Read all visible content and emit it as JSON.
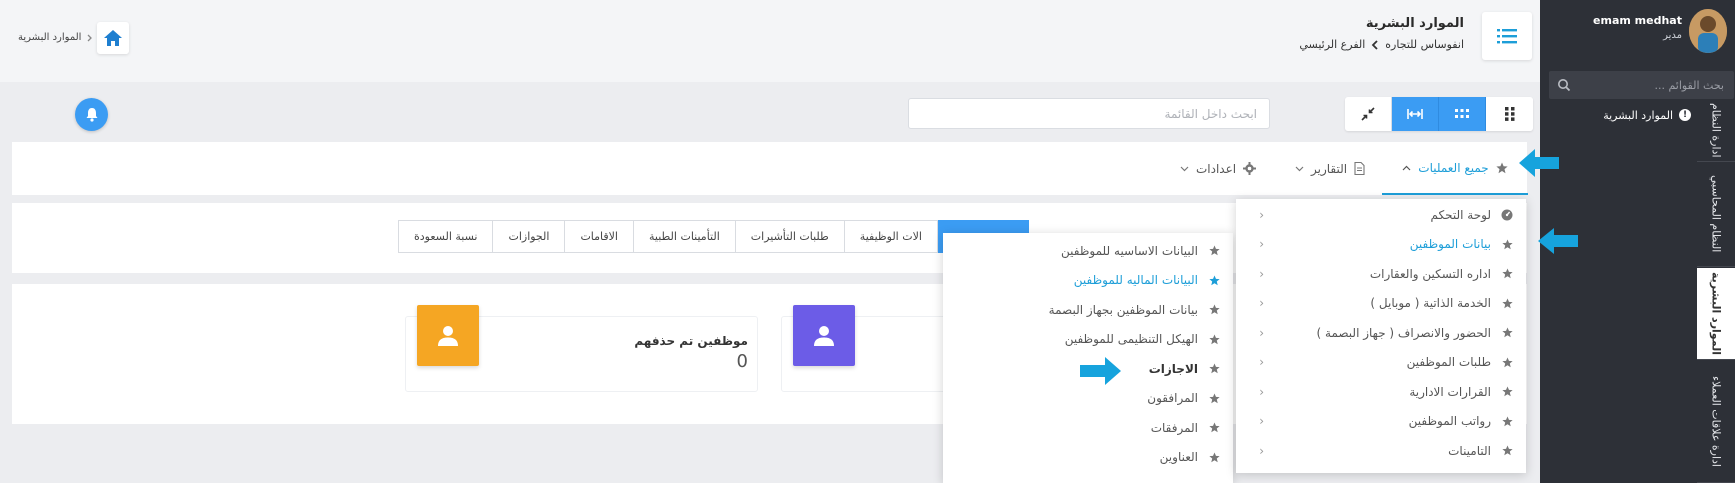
{
  "sidebar": {
    "user_name": "emam medhat",
    "user_role": "مدير",
    "search_placeholder": "بحث القوائم ...",
    "active_item": "الموارد البشرية",
    "vertical_tabs": [
      "ادارة النظام",
      "النظام المحاسبي",
      "الموارد البشرية",
      "ادارة علاقات العملاء"
    ]
  },
  "header": {
    "title": "الموارد البشرية",
    "breadcrumb": [
      "انفوساس للتجاره",
      "الفرع الرئيسي"
    ],
    "left_breadcrumb": "الموارد البشرية"
  },
  "toolbar": {
    "search_placeholder": "ابحث داخل القائمة"
  },
  "tabs": [
    {
      "label": "جميع العمليات",
      "active": true
    },
    {
      "label": "التقارير"
    },
    {
      "label": "اعدادات"
    }
  ],
  "subtabs": [
    {
      "label": "",
      "active": true
    },
    {
      "label": "الات الوظيفية"
    },
    {
      "label": "طلبات التأشيرات"
    },
    {
      "label": "التأمينات الطبية"
    },
    {
      "label": "الاقامات"
    },
    {
      "label": "الجوازات"
    },
    {
      "label": "نسبة السعودة"
    }
  ],
  "stats": [
    {
      "label": "موظفين تم حذفهم",
      "value": "0",
      "color": "#f5a623"
    },
    {
      "color": "#6c5ce7"
    }
  ],
  "dropdown_main": [
    {
      "label": "لوحة التحكم",
      "icon": "dashboard-icon"
    },
    {
      "label": "بيانات الموظفين",
      "icon": "star-icon",
      "highlighted": true
    },
    {
      "label": "اداره التسكين والعقارات",
      "icon": "star-icon"
    },
    {
      "label": "الخدمة الذاتية ( موبايل )",
      "icon": "star-icon"
    },
    {
      "label": "الحضور والانصراف ( جهاز البصمة )",
      "icon": "star-icon"
    },
    {
      "label": "طلبات الموظفين",
      "icon": "star-icon"
    },
    {
      "label": "القرارات الادارية",
      "icon": "star-icon"
    },
    {
      "label": "رواتب الموظفين",
      "icon": "star-icon"
    },
    {
      "label": "التامينات",
      "icon": "star-icon"
    }
  ],
  "dropdown_sub": [
    {
      "label": "البيانات الاساسيه للموظفين"
    },
    {
      "label": "البيانات الماليه للموظفين",
      "highlighted": true
    },
    {
      "label": "بيانات الموظفين بجهاز البصمة"
    },
    {
      "label": "الهيكل التنظيمى للموظفين"
    },
    {
      "label": "الاجازات",
      "bold": true
    },
    {
      "label": "المرافقون"
    },
    {
      "label": "المرفقات"
    },
    {
      "label": "العناوين"
    }
  ],
  "colors": {
    "accent": "#1d9ed8",
    "button_blue": "#3b9cf3",
    "sidebar_bg": "#2d3037",
    "stat_orange": "#f5a623",
    "stat_purple": "#6c5ce7"
  }
}
